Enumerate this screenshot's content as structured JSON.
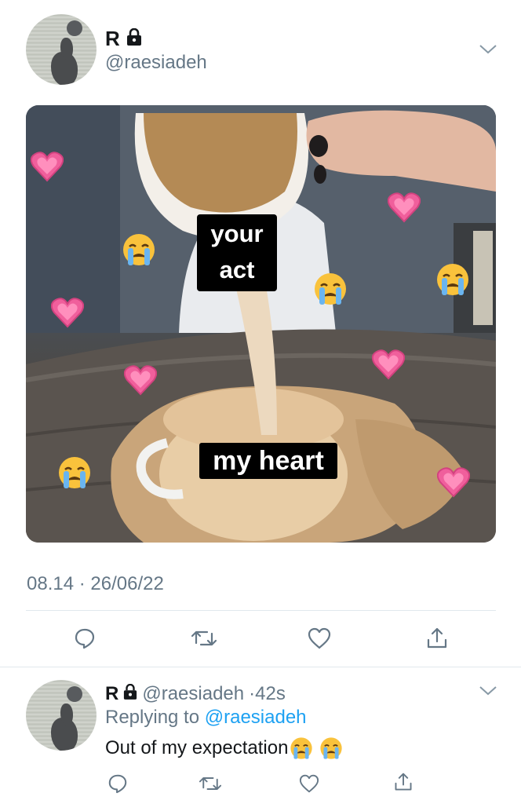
{
  "tweet": {
    "display_name": "R",
    "handle": "@raesiadeh",
    "timestamp": "08.14 · 26/06/22",
    "media": {
      "caption_top_line1": "your",
      "caption_top_line2": "act",
      "caption_bottom": "my heart"
    }
  },
  "reply": {
    "display_name": "R",
    "handle": "@raesiadeh",
    "time_ago": "42s",
    "replying_prefix": "Replying to",
    "replying_handle": "@raesiadeh",
    "text": "Out of my expectation"
  },
  "icons": {
    "lock": "lock-icon",
    "chevron": "chevron-down-icon",
    "reply": "reply-icon",
    "retweet": "retweet-icon",
    "like": "heart-icon",
    "share": "share-icon"
  },
  "colors": {
    "link": "#1da1f2",
    "secondary_text": "#657786",
    "divider": "#e1e8ed"
  }
}
